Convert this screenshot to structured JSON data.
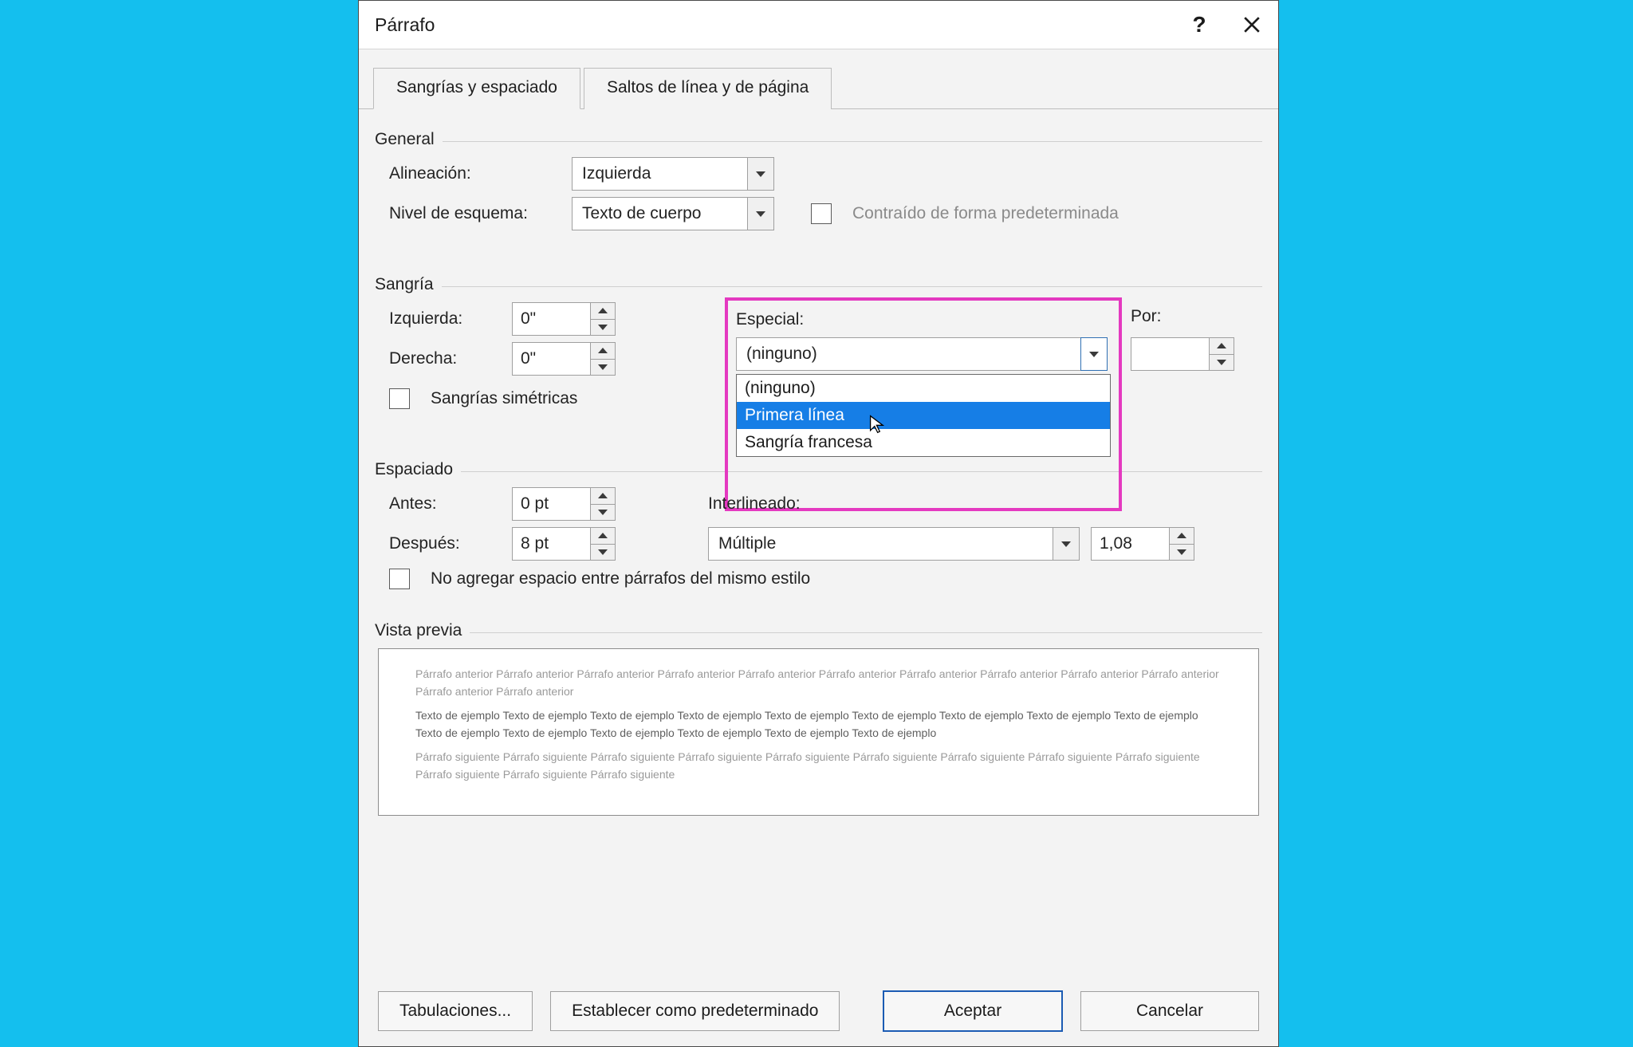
{
  "window": {
    "title": "Párrafo",
    "help": "?",
    "close": "✕"
  },
  "tabs": {
    "indent": "Sangrías y espaciado",
    "breaks": "Saltos de línea y de página"
  },
  "general": {
    "heading": "General",
    "alignment_label": "Alineación:",
    "alignment_value": "Izquierda",
    "outline_label": "Nivel de esquema:",
    "outline_value": "Texto de cuerpo",
    "collapsed_label": "Contraído de forma predeterminada"
  },
  "indent": {
    "heading": "Sangría",
    "left_label": "Izquierda:",
    "left_value": "0\"",
    "right_label": "Derecha:",
    "right_value": "0\"",
    "mirror_label": "Sangrías simétricas",
    "special_label": "Especial:",
    "special_value": "(ninguno)",
    "special_options": [
      "(ninguno)",
      "Primera línea",
      "Sangría francesa"
    ],
    "special_selected_index": 1,
    "by_label": "Por:",
    "by_value": ""
  },
  "spacing": {
    "heading": "Espaciado",
    "before_label": "Antes:",
    "before_value": "0 pt",
    "after_label": "Después:",
    "after_value": "8 pt",
    "linespacing_label": "Interlineado:",
    "linespacing_value": "Múltiple",
    "at_value": "1,08",
    "nospace_label": "No agregar espacio entre párrafos del mismo estilo"
  },
  "preview": {
    "heading": "Vista previa",
    "before_text": "Párrafo anterior Párrafo anterior Párrafo anterior Párrafo anterior Párrafo anterior Párrafo anterior Párrafo anterior Párrafo anterior Párrafo anterior Párrafo anterior Párrafo anterior Párrafo anterior",
    "sample_text": "Texto de ejemplo Texto de ejemplo Texto de ejemplo Texto de ejemplo Texto de ejemplo Texto de ejemplo Texto de ejemplo Texto de ejemplo Texto de ejemplo Texto de ejemplo Texto de ejemplo Texto de ejemplo Texto de ejemplo Texto de ejemplo Texto de ejemplo",
    "after_text": "Párrafo siguiente Párrafo siguiente Párrafo siguiente Párrafo siguiente Párrafo siguiente Párrafo siguiente Párrafo siguiente Párrafo siguiente Párrafo siguiente Párrafo siguiente Párrafo siguiente Párrafo siguiente"
  },
  "footer": {
    "tabs_button": "Tabulaciones...",
    "default_button": "Establecer como predeterminado",
    "ok_button": "Aceptar",
    "cancel_button": "Cancelar"
  }
}
